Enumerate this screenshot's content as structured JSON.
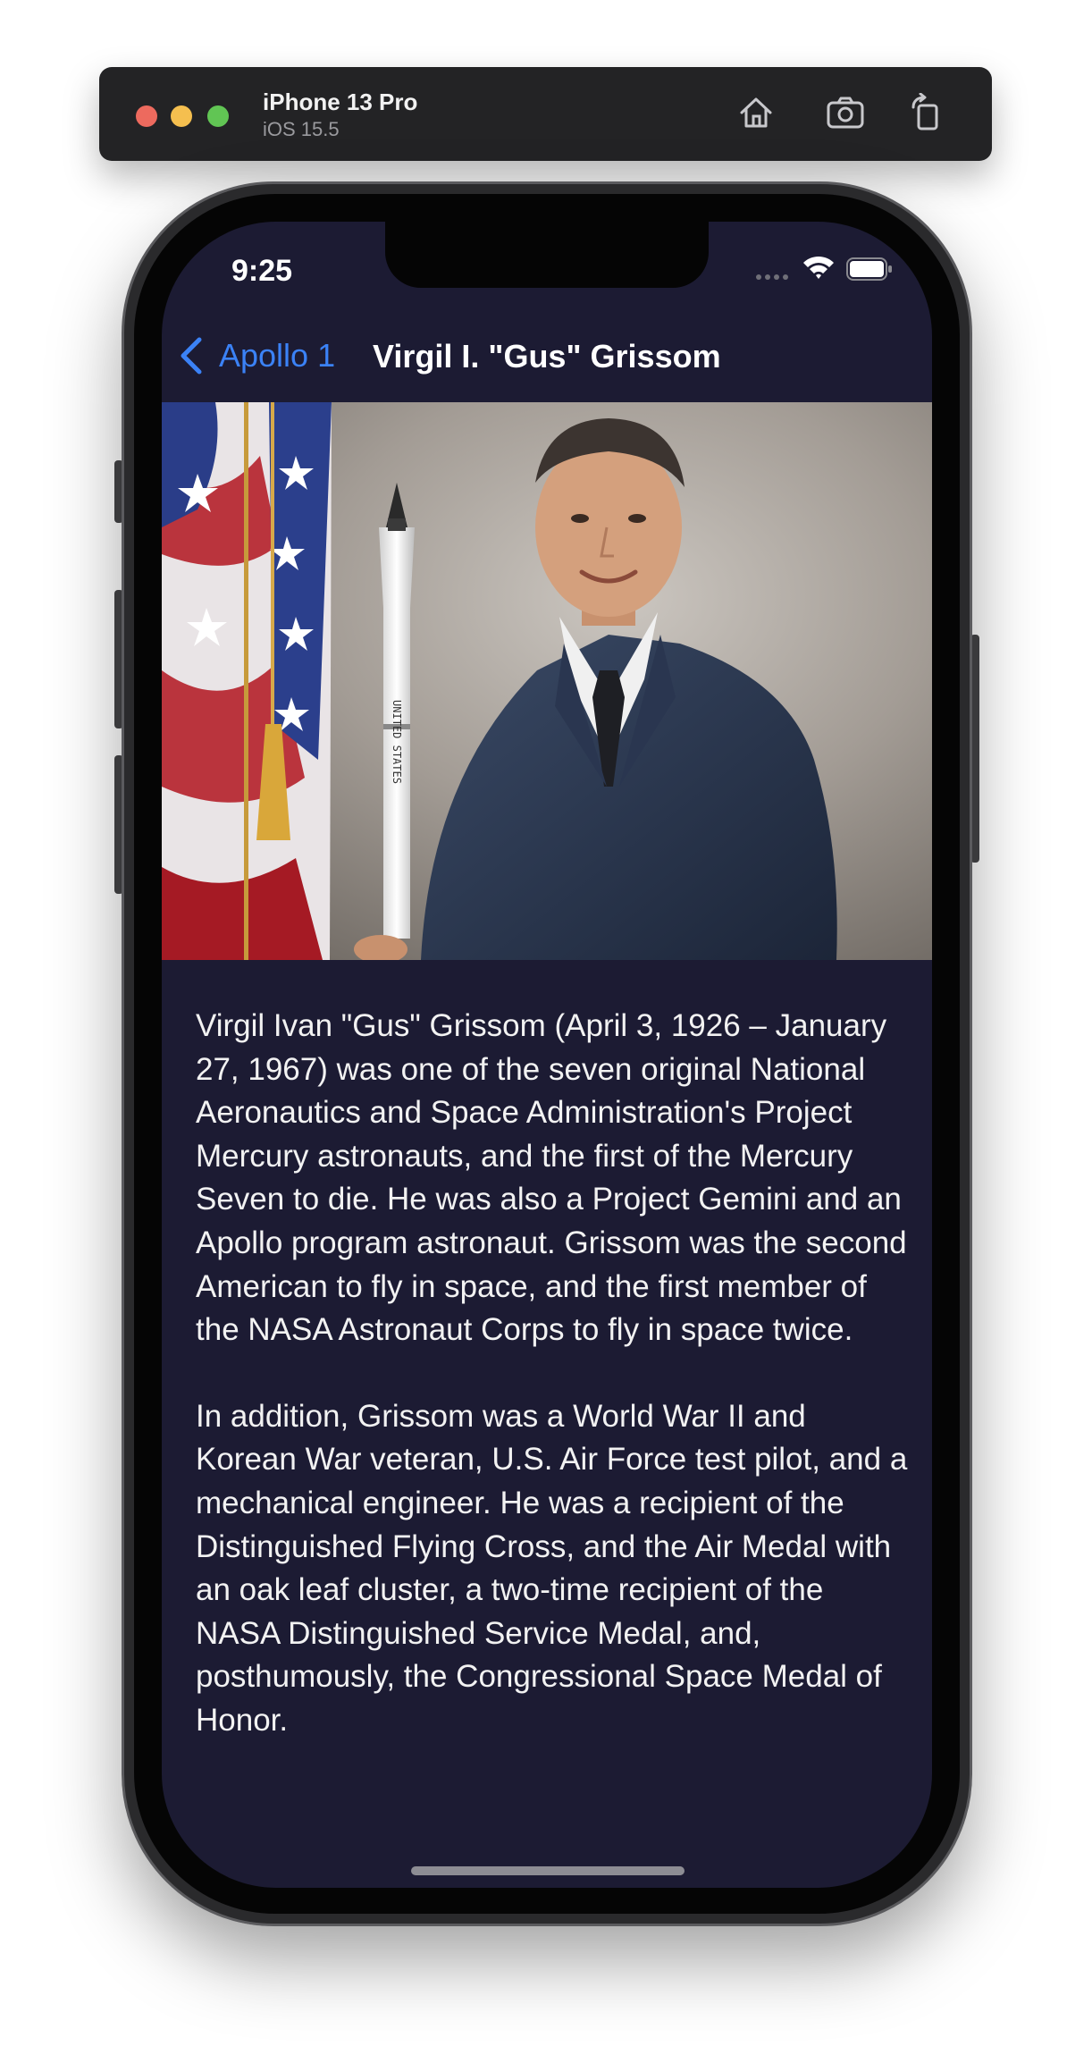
{
  "simulator": {
    "device": "iPhone 13 Pro",
    "os": "iOS 15.5",
    "icons": [
      "home-icon",
      "screenshot-icon",
      "rotate-icon"
    ]
  },
  "status_bar": {
    "time": "9:25"
  },
  "nav": {
    "back_label": "Apollo 1",
    "title": "Virgil I. \"Gus\" Grissom"
  },
  "bio": {
    "paragraphs": [
      "Virgil Ivan \"Gus\" Grissom (April 3, 1926 – January 27, 1967) was one of the seven original National Aeronautics and Space Administration's Project Mercury astronauts, and the first of the Mercury Seven to die. He was also a Project Gemini and an Apollo program astronaut. Grissom was the second American to fly in space, and the first member of the NASA Astronaut Corps to fly in space twice.",
      "In addition, Grissom was a World War II and Korean War veteran, U.S. Air Force test pilot, and a mechanical engineer. He was a recipient of the Distinguished Flying Cross, and the Air Medal with an oak leaf cluster, a two-time recipient of the NASA Distinguished Service Medal, and, posthumously, the Congressional Space Medal of Honor."
    ]
  },
  "photo": {
    "rocket_lettering": "UNITED STATES"
  },
  "colors": {
    "screen_bg": "#1c1b33",
    "accent": "#3b82f6",
    "text": "#f2f2f2"
  }
}
